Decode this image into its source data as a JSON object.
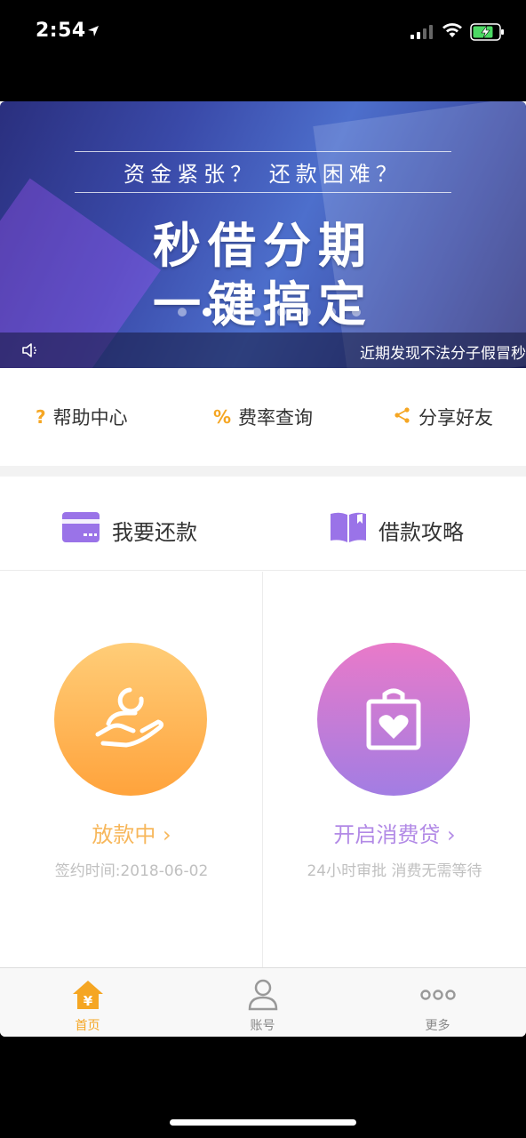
{
  "status_bar": {
    "time": "2:54"
  },
  "banner": {
    "subtitle": "资金紧张？  还款困难？",
    "title_line1": "秒借分期",
    "title_line2": "一键搞定",
    "notice": "近期发现不法分子假冒秒"
  },
  "quick_links": [
    {
      "icon": "?",
      "label": "帮助中心"
    },
    {
      "icon": "%",
      "label": "费率查询"
    },
    {
      "icon": "share-icon",
      "label": "分享好友"
    }
  ],
  "actions": [
    {
      "icon": "credit-card-icon",
      "label": "我要还款"
    },
    {
      "icon": "book-icon",
      "label": "借款攻略"
    }
  ],
  "cards": [
    {
      "icon": "loan-hand-icon",
      "title": "放款中 ›",
      "subtitle": "签约时间:2018-06-02",
      "color": "#f7b75b"
    },
    {
      "icon": "shopping-bag-heart-icon",
      "title": "开启消费贷 ›",
      "subtitle": "24小时审批 消费无需等待",
      "color": "#b28ae6"
    }
  ],
  "tabbar": [
    {
      "label": "首页",
      "icon": "home-yen-icon",
      "active": true
    },
    {
      "label": "账号",
      "icon": "account-icon",
      "active": false
    },
    {
      "label": "更多",
      "icon": "more-icon",
      "active": false
    }
  ],
  "colors": {
    "accent": "#f5a623",
    "purple": "#a27de3",
    "orange": "#ffa33c"
  }
}
